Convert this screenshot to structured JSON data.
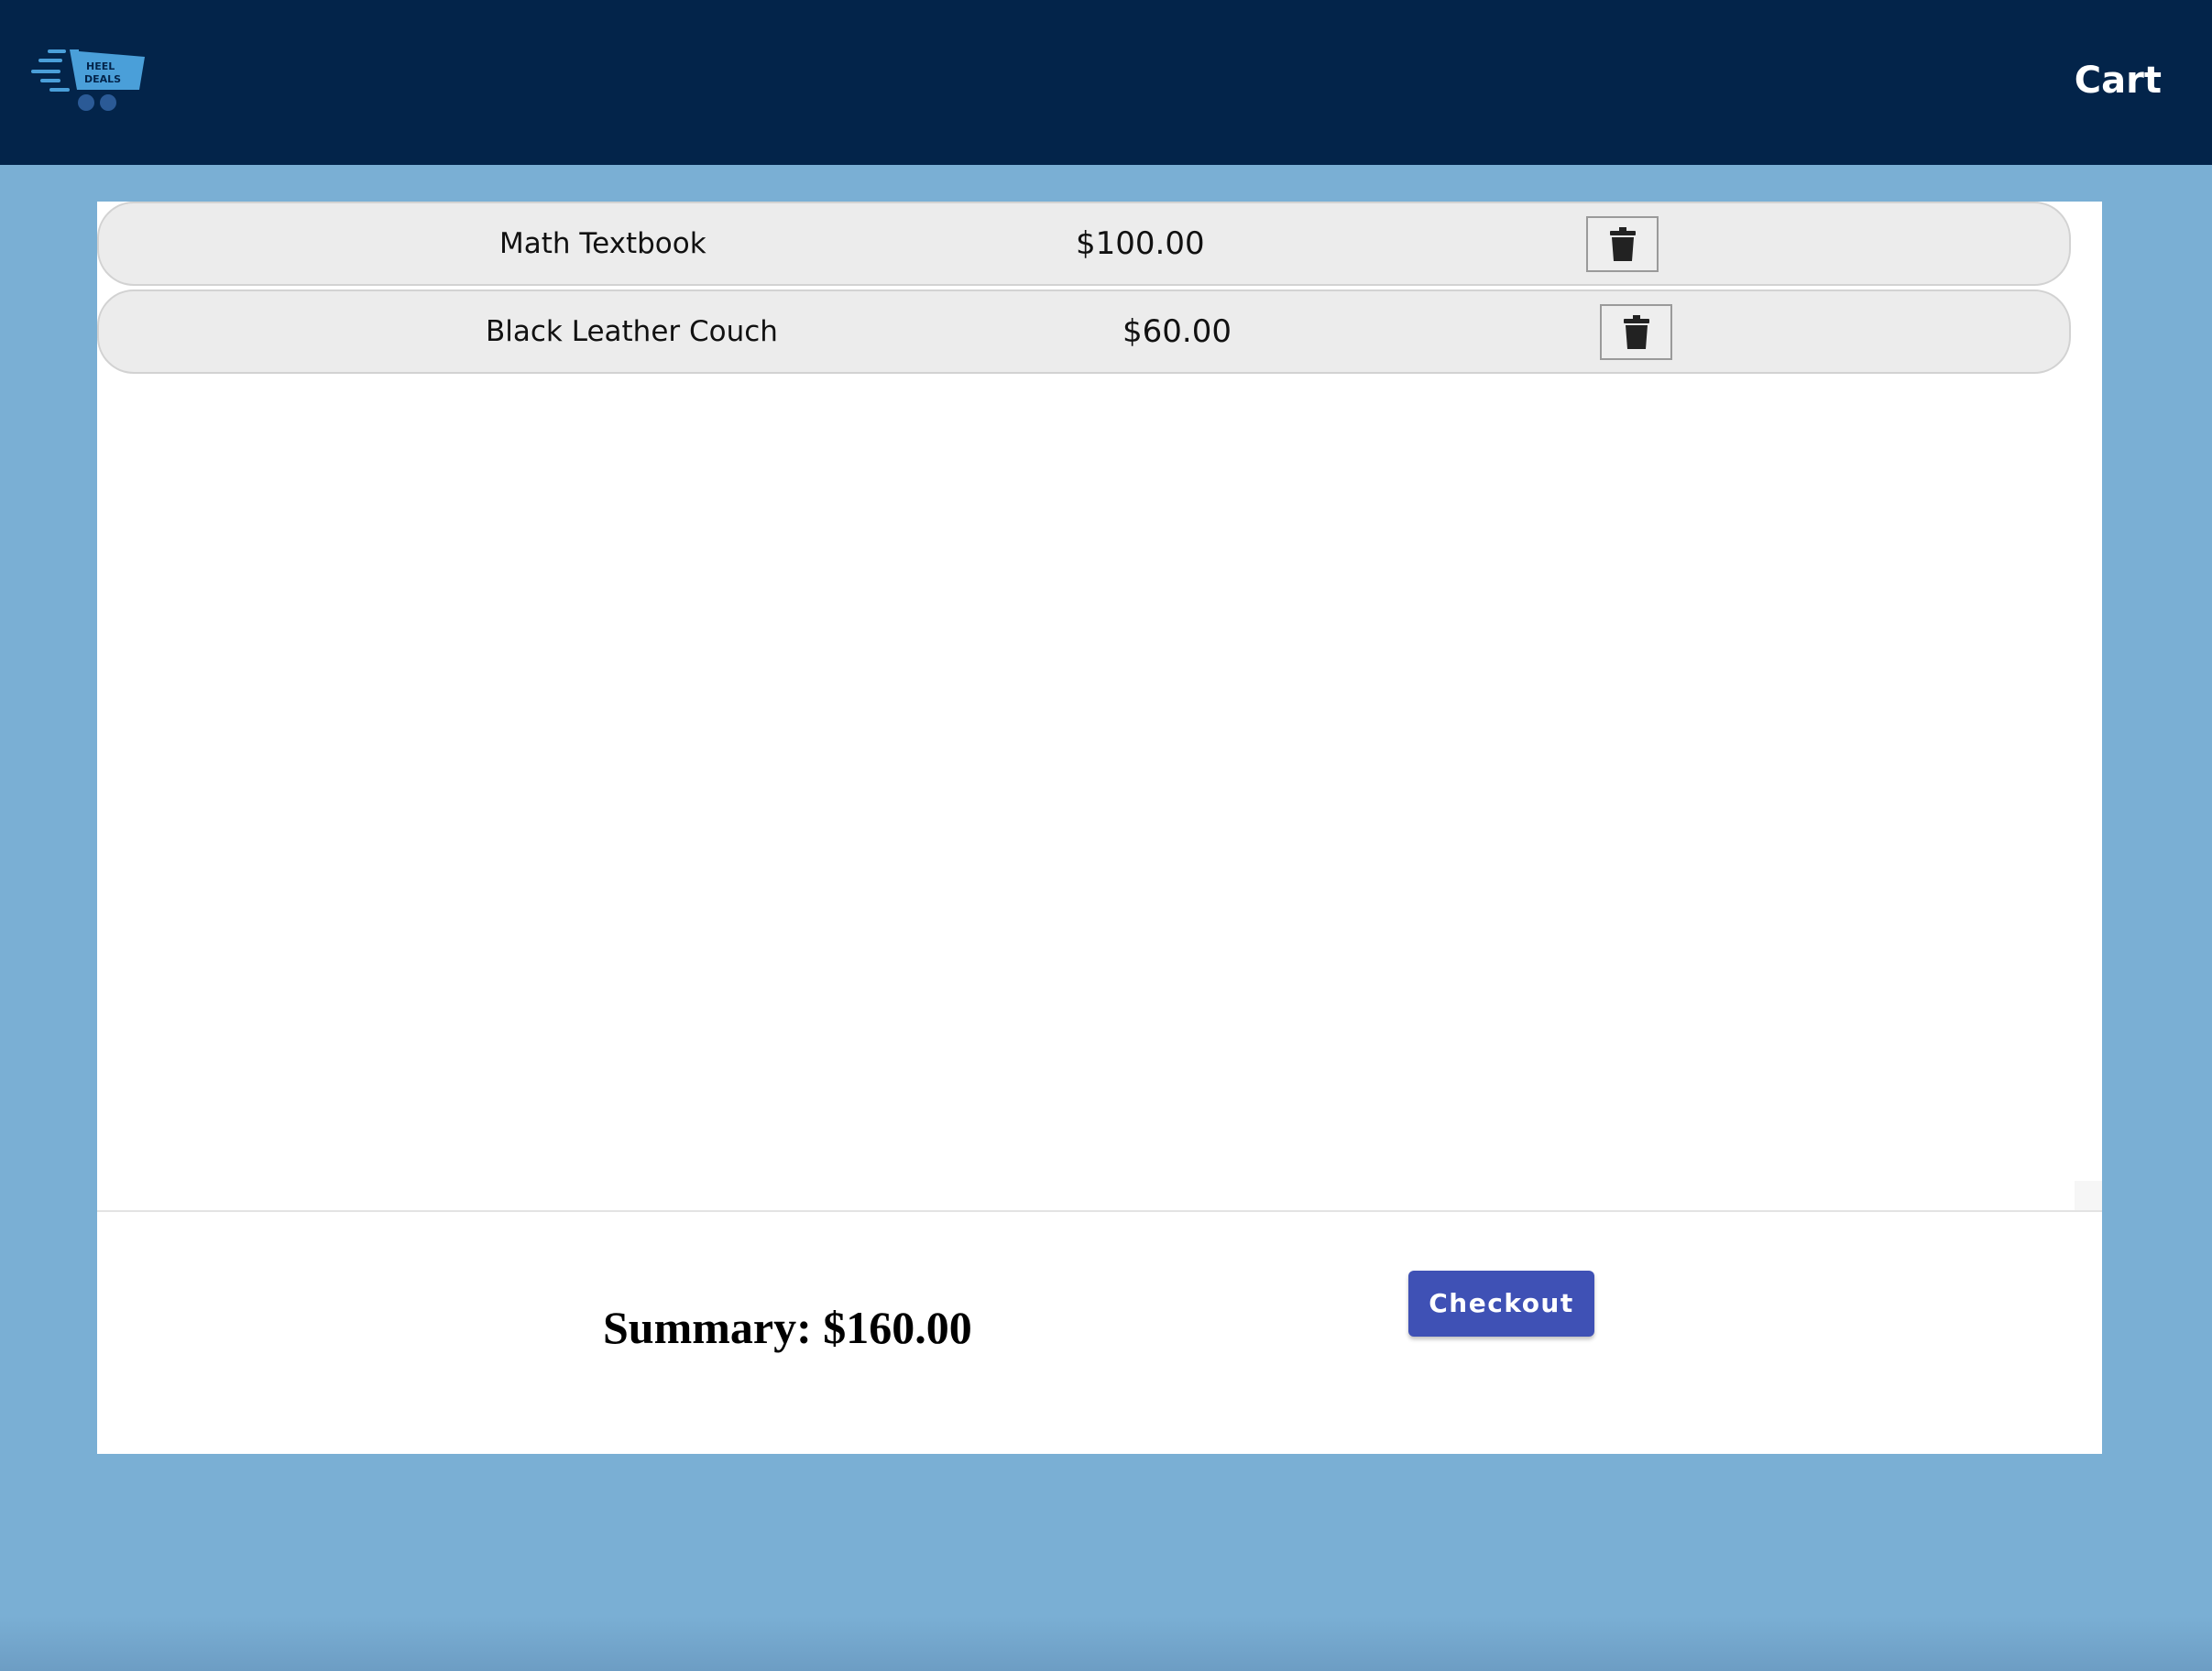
{
  "header": {
    "logo_text_line1": "HEEL",
    "logo_text_line2": "DEALS",
    "title": "Cart"
  },
  "cart": {
    "items": [
      {
        "name": "Math Textbook",
        "price": "$100.00",
        "delete_icon": "trash-icon"
      },
      {
        "name": "Black Leather Couch",
        "price": "$60.00",
        "delete_icon": "trash-icon"
      }
    ]
  },
  "footer": {
    "summary": "Summary: $160.00",
    "checkout_label": "Checkout"
  },
  "colors": {
    "header_bg": "#03244a",
    "page_bg": "#7aafd4",
    "row_bg": "#ececec",
    "checkout_bg": "#3f51b5",
    "logo_accent": "#4a9fd9"
  }
}
